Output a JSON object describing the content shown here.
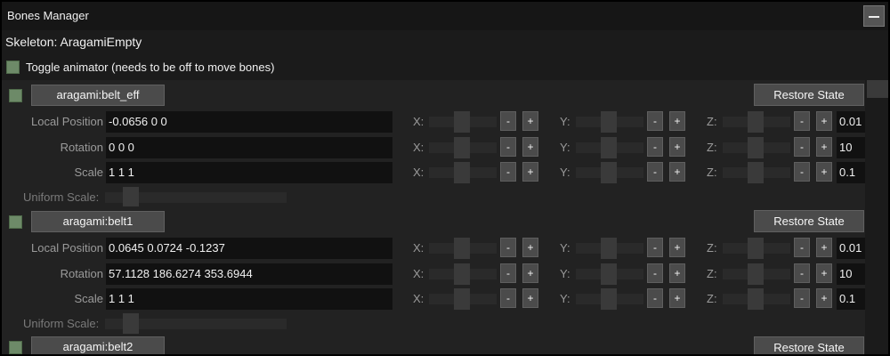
{
  "window": {
    "title": "Bones Manager",
    "minimize_icon": "minimize-icon"
  },
  "skeleton_label": "Skeleton: AragamiEmpty",
  "toggle_animator_label": "Toggle animator (needs to be off to move bones)",
  "colors": {
    "checkbox": "#6d8a68",
    "button": "#4b4b4b",
    "field": "#111111",
    "panel": "#222222"
  },
  "labels": {
    "local_position": "Local Position",
    "rotation": "Rotation",
    "scale": "Scale",
    "uniform_scale": "Uniform Scale:",
    "x": "X:",
    "y": "Y:",
    "z": "Z:",
    "minus": "-",
    "plus": "+",
    "restore": "Restore State"
  },
  "bones": [
    {
      "name": "aragami:belt_eff",
      "local_position": "-0.0656 0 0",
      "rotation": "0 0 0",
      "scale": "1 1 1",
      "pos_step": "0.01",
      "rot_step": "10",
      "scale_step": "0.1"
    },
    {
      "name": "aragami:belt1",
      "local_position": "0.0645 0.0724 -0.1237",
      "rotation": "57.1128 186.6274 353.6944",
      "scale": "1 1 1",
      "pos_step": "0.01",
      "rot_step": "10",
      "scale_step": "0.1"
    },
    {
      "name": "aragami:belt2"
    }
  ]
}
